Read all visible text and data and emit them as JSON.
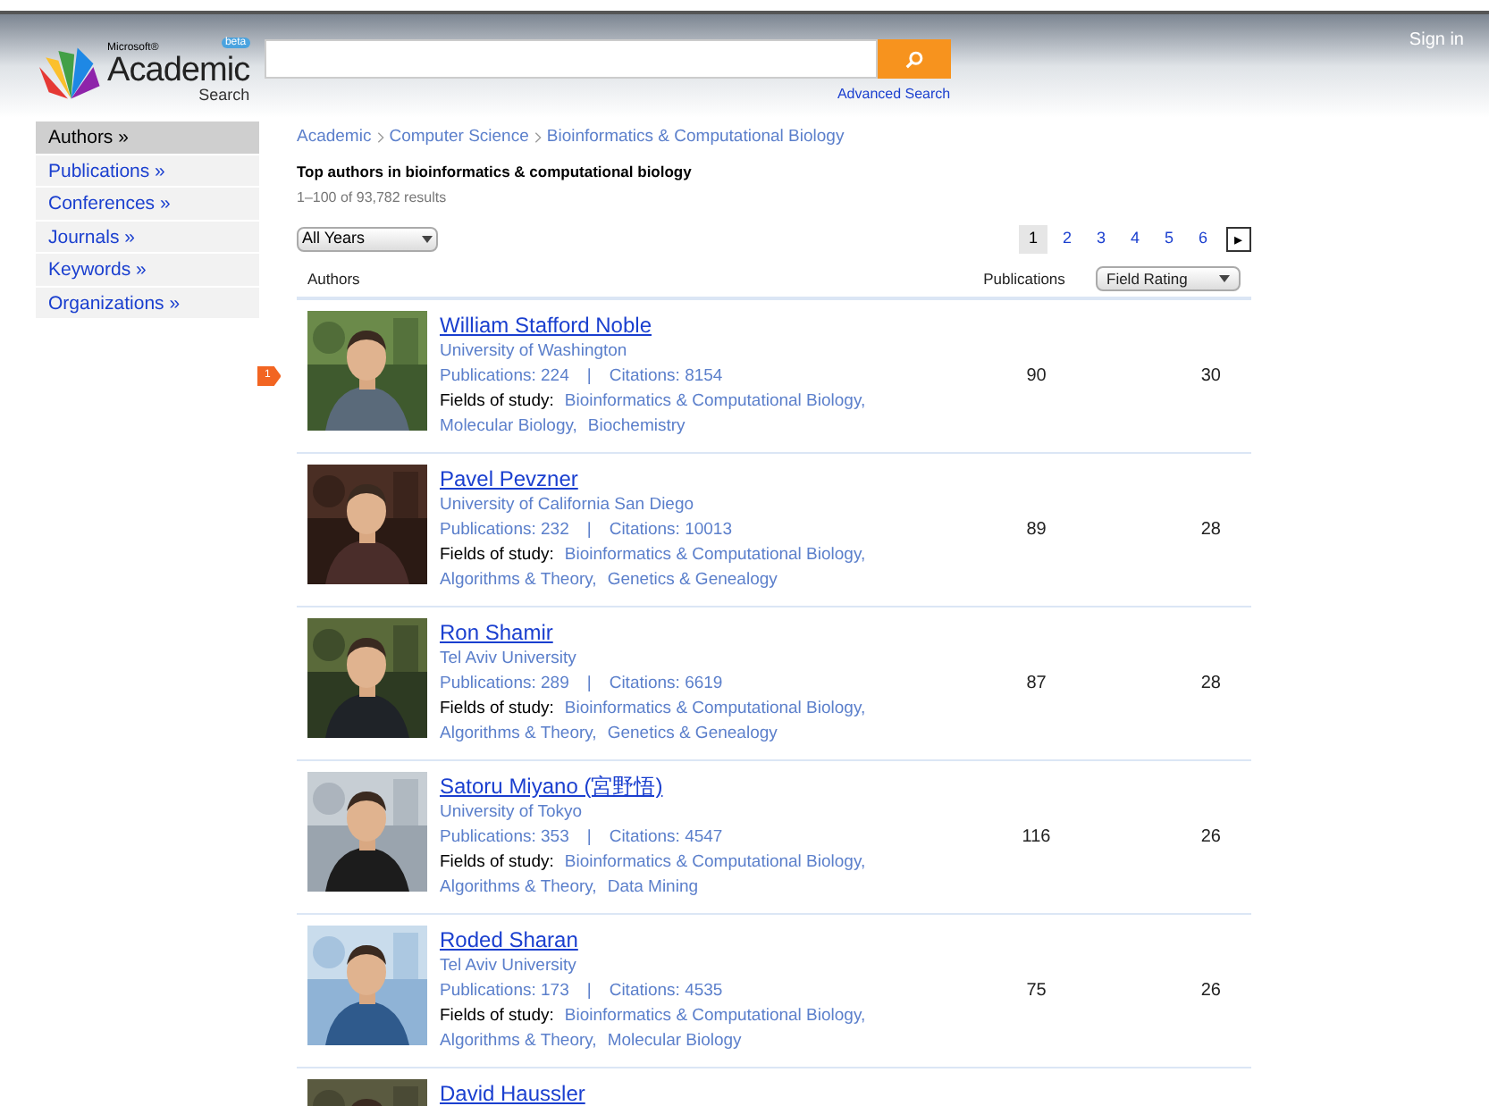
{
  "header": {
    "sign_in": "Sign in",
    "logo": {
      "maker": "Microsoft®",
      "name": "Academic",
      "sub": "Search",
      "badge": "beta"
    },
    "advanced_search": "Advanced Search"
  },
  "sidebar": {
    "items": [
      {
        "label": "Authors »",
        "selected": true
      },
      {
        "label": "Publications »",
        "selected": false
      },
      {
        "label": "Conferences »",
        "selected": false
      },
      {
        "label": "Journals »",
        "selected": false
      },
      {
        "label": "Keywords »",
        "selected": false
      },
      {
        "label": "Organizations »",
        "selected": false
      }
    ]
  },
  "breadcrumb": [
    "Academic",
    "Computer Science",
    "Bioinformatics & Computational Biology"
  ],
  "heading": "Top authors in bioinformatics & computational biology",
  "result_count": "1–100 of 93,782 results",
  "year_filter": "All Years",
  "pagination": {
    "pages": [
      {
        "label": "1",
        "selected": true
      },
      {
        "label": "2",
        "selected": false
      },
      {
        "label": "3",
        "selected": false
      },
      {
        "label": "4",
        "selected": false
      },
      {
        "label": "5",
        "selected": false
      },
      {
        "label": "6",
        "selected": false
      }
    ],
    "next": "▸"
  },
  "table": {
    "columns": [
      "Authors",
      "Publications",
      "Field Rating"
    ],
    "rows": [
      {
        "rank": "1",
        "name": "William Stafford Noble",
        "affiliation": "University of Washington",
        "publications": "Publications: 224",
        "separator": "|",
        "citations": "Citations: 8154",
        "fields_label": "Fields of study:",
        "fields": [
          "Bioinformatics & Computational Biology,",
          "Molecular Biology,",
          "Biochemistry"
        ],
        "publications_count": "90",
        "field_rating": "30"
      },
      {
        "name": "Pavel Pevzner",
        "affiliation": "University of California San Diego",
        "publications": "Publications: 232",
        "separator": "|",
        "citations": "Citations: 10013",
        "fields_label": "Fields of study:",
        "fields": [
          "Bioinformatics & Computational Biology,",
          "Algorithms & Theory,",
          "Genetics & Genealogy"
        ],
        "publications_count": "89",
        "field_rating": "28"
      },
      {
        "name": "Ron Shamir",
        "affiliation": "Tel Aviv University",
        "publications": "Publications: 289",
        "separator": "|",
        "citations": "Citations: 6619",
        "fields_label": "Fields of study:",
        "fields": [
          "Bioinformatics & Computational Biology,",
          "Algorithms & Theory,",
          "Genetics & Genealogy"
        ],
        "publications_count": "87",
        "field_rating": "28"
      },
      {
        "name": "Satoru Miyano (宮野悟)",
        "affiliation": "University of Tokyo",
        "publications": "Publications: 353",
        "separator": "|",
        "citations": "Citations: 4547",
        "fields_label": "Fields of study:",
        "fields": [
          "Bioinformatics & Computational Biology,",
          "Algorithms & Theory,",
          "Data Mining"
        ],
        "publications_count": "116",
        "field_rating": "26"
      },
      {
        "name": "Roded Sharan",
        "affiliation": "Tel Aviv University",
        "publications": "Publications: 173",
        "separator": "|",
        "citations": "Citations: 4535",
        "fields_label": "Fields of study:",
        "fields": [
          "Bioinformatics & Computational Biology,",
          "Algorithms & Theory,",
          "Molecular Biology"
        ],
        "publications_count": "75",
        "field_rating": "26"
      },
      {
        "name": "David Haussler"
      }
    ]
  }
}
